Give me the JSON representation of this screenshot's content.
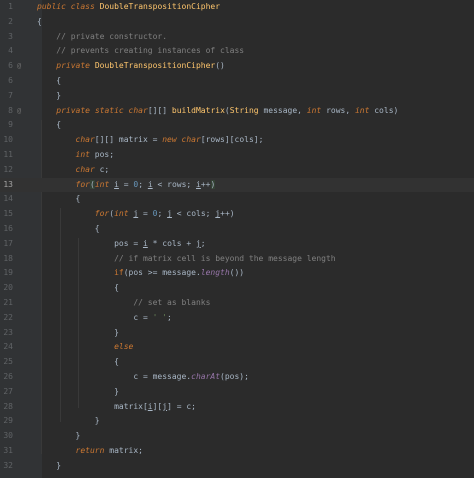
{
  "editor": {
    "active_line": 13,
    "lines": [
      {
        "n": "1",
        "marker": "",
        "tokens": [
          [
            "kw",
            "public"
          ],
          [
            "t",
            " "
          ],
          [
            "kw",
            "class"
          ],
          [
            "t",
            " "
          ],
          [
            "cls",
            "DoubleTranspositionCipher"
          ]
        ]
      },
      {
        "n": "2",
        "marker": "",
        "tokens": [
          [
            "t",
            "{"
          ]
        ]
      },
      {
        "n": "3",
        "marker": "",
        "tokens": [
          [
            "t",
            "    "
          ],
          [
            "cm",
            "// private constructor."
          ]
        ]
      },
      {
        "n": "4",
        "marker": "",
        "tokens": [
          [
            "t",
            "    "
          ],
          [
            "cm",
            "// prevents creating instances of class"
          ]
        ]
      },
      {
        "n": "6",
        "marker": "@",
        "tokens": [
          [
            "t",
            "    "
          ],
          [
            "kw",
            "private"
          ],
          [
            "t",
            " "
          ],
          [
            "fn",
            "DoubleTranspositionCipher"
          ],
          [
            "t",
            "()"
          ]
        ]
      },
      {
        "n": "6",
        "marker": "",
        "tokens": [
          [
            "t",
            "    {"
          ]
        ]
      },
      {
        "n": "7",
        "marker": "",
        "tokens": [
          [
            "t",
            "    }"
          ]
        ]
      },
      {
        "n": "8",
        "marker": "@",
        "tokens": [
          [
            "t",
            "    "
          ],
          [
            "kw",
            "private"
          ],
          [
            "t",
            " "
          ],
          [
            "kw",
            "static"
          ],
          [
            "t",
            " "
          ],
          [
            "kw",
            "char"
          ],
          [
            "t",
            "[][] "
          ],
          [
            "fn",
            "buildMatrix"
          ],
          [
            "t",
            "("
          ],
          [
            "cls",
            "String"
          ],
          [
            "t",
            " message, "
          ],
          [
            "kw",
            "int"
          ],
          [
            "t",
            " rows, "
          ],
          [
            "kw",
            "int"
          ],
          [
            "t",
            " cols)"
          ]
        ]
      },
      {
        "n": "9",
        "marker": "",
        "tokens": [
          [
            "t",
            "    {"
          ]
        ]
      },
      {
        "n": "10",
        "marker": "",
        "tokens": [
          [
            "t",
            "        "
          ],
          [
            "kw",
            "char"
          ],
          [
            "t",
            "[][] matrix = "
          ],
          [
            "kw",
            "new"
          ],
          [
            "t",
            " "
          ],
          [
            "kw",
            "char"
          ],
          [
            "t",
            "[rows][cols];"
          ]
        ]
      },
      {
        "n": "11",
        "marker": "",
        "tokens": [
          [
            "t",
            "        "
          ],
          [
            "kw",
            "int"
          ],
          [
            "t",
            " pos;"
          ]
        ]
      },
      {
        "n": "12",
        "marker": "",
        "tokens": [
          [
            "t",
            "        "
          ],
          [
            "kw",
            "char"
          ],
          [
            "t",
            " c;"
          ]
        ]
      },
      {
        "n": "13",
        "marker": "",
        "tokens": [
          [
            "t",
            "        "
          ],
          [
            "kw",
            "for"
          ],
          [
            "hl",
            "("
          ],
          [
            "kw",
            "int"
          ],
          [
            "t",
            " "
          ],
          [
            "var",
            "i"
          ],
          [
            "t",
            " = "
          ],
          [
            "num",
            "0"
          ],
          [
            "t",
            "; "
          ],
          [
            "var",
            "i"
          ],
          [
            "t",
            " < rows; "
          ],
          [
            "var",
            "i"
          ],
          [
            "t",
            "++"
          ],
          [
            "hl",
            ")"
          ]
        ]
      },
      {
        "n": "14",
        "marker": "",
        "tokens": [
          [
            "t",
            "        {"
          ]
        ]
      },
      {
        "n": "15",
        "marker": "",
        "tokens": [
          [
            "t",
            "            "
          ],
          [
            "kw",
            "for"
          ],
          [
            "t",
            "("
          ],
          [
            "kw",
            "int"
          ],
          [
            "t",
            " "
          ],
          [
            "var",
            "j"
          ],
          [
            "t",
            " = "
          ],
          [
            "num",
            "0"
          ],
          [
            "t",
            "; "
          ],
          [
            "var",
            "j"
          ],
          [
            "t",
            " < cols; "
          ],
          [
            "var",
            "j"
          ],
          [
            "t",
            "++)"
          ]
        ]
      },
      {
        "n": "16",
        "marker": "",
        "tokens": [
          [
            "t",
            "            {"
          ]
        ]
      },
      {
        "n": "17",
        "marker": "",
        "tokens": [
          [
            "t",
            "                pos = "
          ],
          [
            "var",
            "i"
          ],
          [
            "t",
            " * cols + "
          ],
          [
            "var",
            "j"
          ],
          [
            "t",
            ";"
          ]
        ]
      },
      {
        "n": "18",
        "marker": "",
        "tokens": [
          [
            "t",
            "                "
          ],
          [
            "cm",
            "// if matrix cell is beyond the message length"
          ]
        ]
      },
      {
        "n": "19",
        "marker": "",
        "tokens": [
          [
            "t",
            "                "
          ],
          [
            "kwn",
            "if"
          ],
          [
            "t",
            "(pos >= message."
          ],
          [
            "mcall",
            "length"
          ],
          [
            "t",
            "())"
          ]
        ]
      },
      {
        "n": "20",
        "marker": "",
        "tokens": [
          [
            "t",
            "                {"
          ]
        ]
      },
      {
        "n": "21",
        "marker": "",
        "tokens": [
          [
            "t",
            "                    "
          ],
          [
            "cm",
            "// set as blanks"
          ]
        ]
      },
      {
        "n": "22",
        "marker": "",
        "tokens": [
          [
            "t",
            "                    c = "
          ],
          [
            "str",
            "' '"
          ],
          [
            "t",
            ";"
          ]
        ]
      },
      {
        "n": "23",
        "marker": "",
        "tokens": [
          [
            "t",
            "                }"
          ]
        ]
      },
      {
        "n": "24",
        "marker": "",
        "tokens": [
          [
            "t",
            "                "
          ],
          [
            "kw",
            "else"
          ]
        ]
      },
      {
        "n": "25",
        "marker": "",
        "tokens": [
          [
            "t",
            "                {"
          ]
        ]
      },
      {
        "n": "26",
        "marker": "",
        "tokens": [
          [
            "t",
            "                    c = message."
          ],
          [
            "mcall",
            "charAt"
          ],
          [
            "t",
            "(pos);"
          ]
        ]
      },
      {
        "n": "27",
        "marker": "",
        "tokens": [
          [
            "t",
            "                }"
          ]
        ]
      },
      {
        "n": "28",
        "marker": "",
        "tokens": [
          [
            "t",
            "                matrix["
          ],
          [
            "var",
            "i"
          ],
          [
            "t",
            "]["
          ],
          [
            "var",
            "j"
          ],
          [
            "t",
            "] = c;"
          ]
        ]
      },
      {
        "n": "29",
        "marker": "",
        "tokens": [
          [
            "t",
            "            }"
          ]
        ]
      },
      {
        "n": "30",
        "marker": "",
        "tokens": [
          [
            "t",
            "        }"
          ]
        ]
      },
      {
        "n": "31",
        "marker": "",
        "tokens": [
          [
            "t",
            "        "
          ],
          [
            "kw",
            "return"
          ],
          [
            "t",
            " matrix;"
          ]
        ]
      },
      {
        "n": "32",
        "marker": "",
        "tokens": [
          [
            "t",
            "    }"
          ]
        ]
      }
    ]
  }
}
